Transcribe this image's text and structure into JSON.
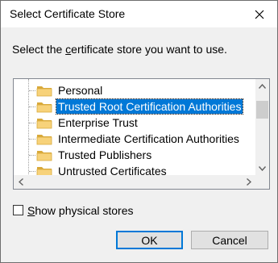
{
  "dialog": {
    "title": "Select Certificate Store",
    "instruction_prefix": "Select the ",
    "instruction_underlined": "c",
    "instruction_suffix": "ertificate store you want to use."
  },
  "stores": [
    {
      "label": "Personal",
      "selected": false
    },
    {
      "label": "Trusted Root Certification Authorities",
      "selected": true
    },
    {
      "label": "Enterprise Trust",
      "selected": false
    },
    {
      "label": "Intermediate Certification Authorities",
      "selected": false
    },
    {
      "label": "Trusted Publishers",
      "selected": false
    },
    {
      "label": "Untrusted Certificates",
      "selected": false
    }
  ],
  "show_physical": {
    "checked": false,
    "label_underlined": "S",
    "label_rest": "how physical stores"
  },
  "buttons": {
    "ok": "OK",
    "cancel": "Cancel"
  },
  "colors": {
    "selection": "#0078d7",
    "folder_fill": "#f7d27a",
    "folder_edge": "#d8a93a",
    "default_button_border": "#0078d7"
  },
  "icons": {
    "close": "close-icon",
    "folder": "folder-icon",
    "scroll_up": "arrow-up-icon",
    "scroll_down": "arrow-down-icon",
    "scroll_left": "arrow-left-icon",
    "scroll_right": "arrow-right-icon"
  }
}
